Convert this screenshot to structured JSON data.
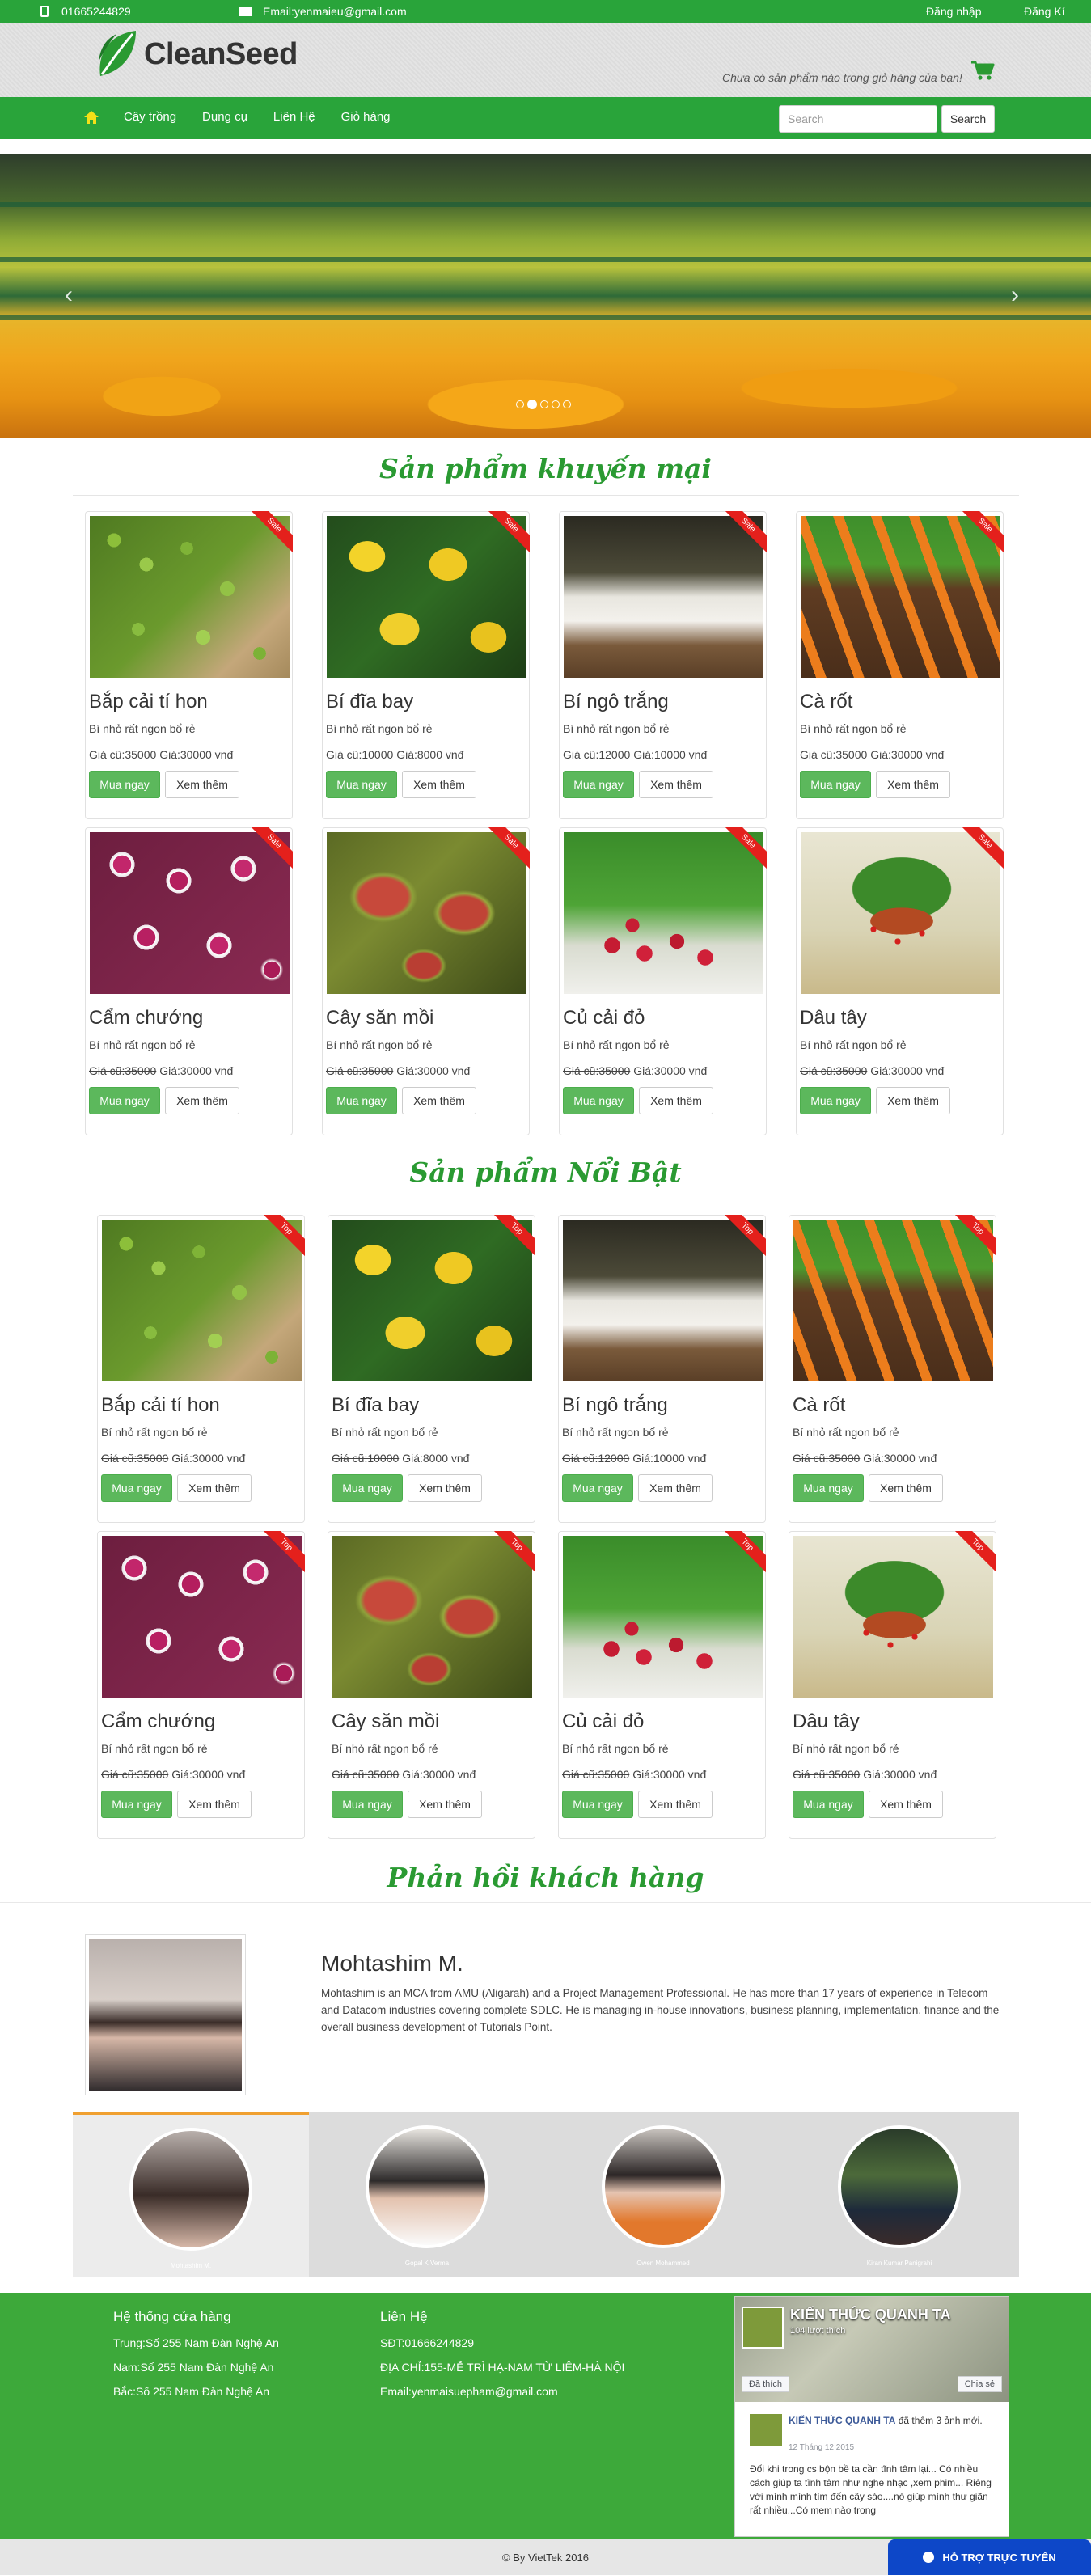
{
  "topbar": {
    "phone": "01665244829",
    "email": "Email:yenmaieu@gmail.com",
    "login": "Đăng nhập",
    "register": "Đăng Kí"
  },
  "header": {
    "logo": "CleanSeed",
    "cart_note": "Chưa có sản phẩm nào trong giỏ hàng của bạn!"
  },
  "nav": {
    "items": [
      "Cây trồng",
      "Dụng cụ",
      "Liên Hệ",
      "Giỏ hàng"
    ],
    "search_placeholder": "Search",
    "search_button": "Search"
  },
  "carousel": {
    "slides": 5,
    "active": 1
  },
  "sections": {
    "promo_title": "Sản phẩm khuyến mại",
    "featured_title": "Sản phẩm Nổi Bật",
    "feedback_title": "Phản hồi khách hàng"
  },
  "labels": {
    "buy": "Mua ngay",
    "more": "Xem thêm",
    "sale_badge": "Sale",
    "top_badge": "Top"
  },
  "promo_products": [
    {
      "name": "Bắp cải tí hon",
      "desc": "Bí nhỏ rất ngon bổ rẻ",
      "old": "Giá cũ:35000",
      "new": "Giá:30000 vnđ",
      "art": "sprout"
    },
    {
      "name": "Bí đĩa bay",
      "desc": "Bí nhỏ rất ngon bổ rẻ",
      "old": "Giá cũ:10000",
      "new": "Giá:8000 vnđ",
      "art": "squash"
    },
    {
      "name": "Bí ngô trắng",
      "desc": "Bí nhỏ rất ngon bổ rẻ",
      "old": "Giá cũ:12000",
      "new": "Giá:10000 vnđ",
      "art": "pumpkin"
    },
    {
      "name": "Cà rốt",
      "desc": "Bí nhỏ rất ngon bổ rẻ",
      "old": "Giá cũ:35000",
      "new": "Giá:30000 vnđ",
      "art": "carrot"
    },
    {
      "name": "Cẩm chướng",
      "desc": "Bí nhỏ rất ngon bổ rẻ",
      "old": "Giá cũ:35000",
      "new": "Giá:30000 vnđ",
      "art": "flower"
    },
    {
      "name": "Cây săn mồi",
      "desc": "Bí nhỏ rất ngon bổ rẻ",
      "old": "Giá cũ:35000",
      "new": "Giá:30000 vnđ",
      "art": "flytrap"
    },
    {
      "name": "Củ cải đỏ",
      "desc": "Bí nhỏ rất ngon bổ rẻ",
      "old": "Giá cũ:35000",
      "new": "Giá:30000 vnđ",
      "art": "radish"
    },
    {
      "name": "Dâu tây",
      "desc": "Bí nhỏ rất ngon bổ rẻ",
      "old": "Giá cũ:35000",
      "new": "Giá:30000 vnđ",
      "art": "straw"
    }
  ],
  "featured_products": [
    {
      "name": "Bắp cải tí hon",
      "desc": "Bí nhỏ rất ngon bổ rẻ",
      "old": "Giá cũ:35000",
      "new": "Giá:30000 vnđ",
      "art": "sprout"
    },
    {
      "name": "Bí đĩa bay",
      "desc": "Bí nhỏ rất ngon bổ rẻ",
      "old": "Giá cũ:10000",
      "new": "Giá:8000 vnđ",
      "art": "squash"
    },
    {
      "name": "Bí ngô trắng",
      "desc": "Bí nhỏ rất ngon bổ rẻ",
      "old": "Giá cũ:12000",
      "new": "Giá:10000 vnđ",
      "art": "pumpkin"
    },
    {
      "name": "Cà rốt",
      "desc": "Bí nhỏ rất ngon bổ rẻ",
      "old": "Giá cũ:35000",
      "new": "Giá:30000 vnđ",
      "art": "carrot"
    },
    {
      "name": "Cẩm chướng",
      "desc": "Bí nhỏ rất ngon bổ rẻ",
      "old": "Giá cũ:35000",
      "new": "Giá:30000 vnđ",
      "art": "flower"
    },
    {
      "name": "Cây săn mồi",
      "desc": "Bí nhỏ rất ngon bổ rẻ",
      "old": "Giá cũ:35000",
      "new": "Giá:30000 vnđ",
      "art": "flytrap"
    },
    {
      "name": "Củ cải đỏ",
      "desc": "Bí nhỏ rất ngon bổ rẻ",
      "old": "Giá cũ:35000",
      "new": "Giá:30000 vnđ",
      "art": "radish"
    },
    {
      "name": "Dâu tây",
      "desc": "Bí nhỏ rất ngon bổ rẻ",
      "old": "Giá cũ:35000",
      "new": "Giá:30000 vnđ",
      "art": "straw"
    }
  ],
  "feedback": {
    "name": "Mohtashim M.",
    "text": "Mohtashim is an MCA from AMU (Aligarah) and a Project Management Professional. He has more than 17 years of experience in Telecom and Datacom industries covering complete SDLC. He is managing in-house innovations, business planning, implementation, finance and the overall business development of Tutorials Point.",
    "thumbs": [
      "Mohtashim M.",
      "Gopal K Verma",
      "Owen Mohammed",
      "Kiran Kumar Panigrahi"
    ]
  },
  "footer": {
    "stores_title": "Hệ thống cửa hàng",
    "stores": [
      "Trung:Số 255 Nam Đàn Nghệ An",
      "Nam:Số 255 Nam Đàn Nghệ An",
      "Bắc:Số 255 Nam Đàn Nghệ An"
    ],
    "contact_title": "Liên Hệ",
    "contact": [
      "SĐT:01666244829",
      "ĐỊA CHỈ:155-MỄ TRÌ HẠ-NAM TỪ LIÊM-HÀ NỘI",
      "Email:yenmaisuepham@gmail.com"
    ],
    "fb": {
      "page": "KIẾN THỨC QUANH TA",
      "likes": "104 lượt thích",
      "like_btn": "Đã thích",
      "share_btn": "Chia sẻ",
      "post_author": "KIẾN THỨC QUANH TA",
      "post_action": "đã thêm 3 ảnh mới.",
      "post_date": "12 Tháng 12 2015",
      "post_body": "Đối khi trong cs bộn bề ta cần tĩnh tâm lại... Có nhiều cách giúp ta tĩnh tâm như nghe nhạc ,xem phim... Riêng với mình mình tìm đến cây sáo....nó giúp mình thư giãn rất nhiều...Có mem nào trong"
    },
    "copyright": "© By VietTek 2016",
    "support": "HỖ TRỢ TRỰC TUYẾN"
  }
}
